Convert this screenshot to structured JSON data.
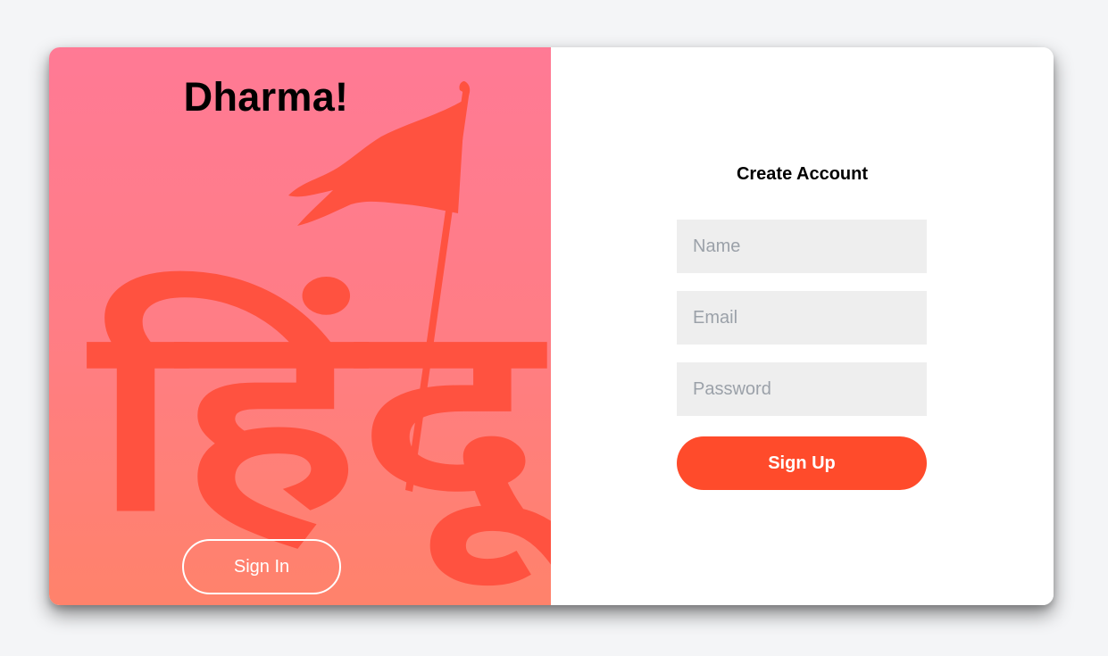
{
  "brand": {
    "title": "Dharma!",
    "art_text": "हिंदू"
  },
  "left_panel": {
    "signin_label": "Sign In"
  },
  "form": {
    "title": "Create Account",
    "name_placeholder": "Name",
    "email_placeholder": "Email",
    "password_placeholder": "Password",
    "signup_label": "Sign Up"
  },
  "colors": {
    "accent": "#ff4b2b",
    "panel_gradient_top": "#ff7a95",
    "panel_gradient_bottom": "#ff826b",
    "art_color": "#ff5240",
    "input_background": "#eeeeee",
    "page_background": "#f4f5f7"
  },
  "icons": {
    "art": "saffron-flag-icon"
  }
}
